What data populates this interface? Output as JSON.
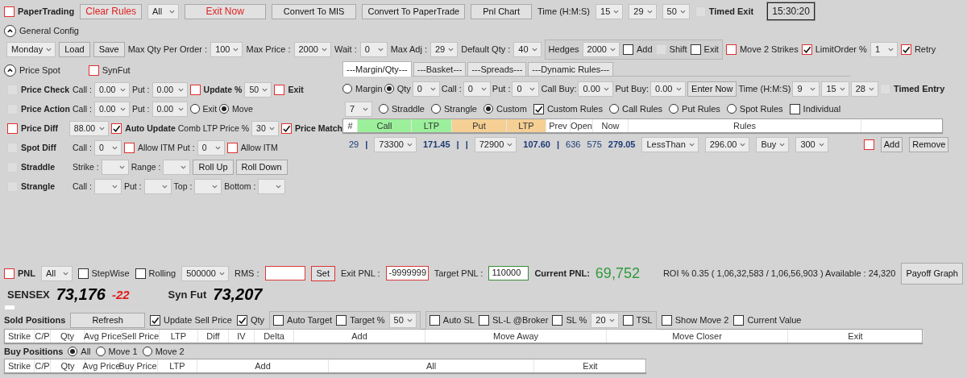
{
  "header_bar": [
    {
      "kind": "check",
      "label": "PaperTrading",
      "checked": false,
      "bold": true,
      "color": "#e0302f"
    },
    {
      "kind": "button",
      "label": "Clear Rules",
      "alert": true
    },
    {
      "kind": "select",
      "value": "All"
    },
    {
      "kind": "button",
      "label": "Exit Now",
      "alert": true
    },
    {
      "kind": "button",
      "label": "Convert To MIS"
    },
    {
      "kind": "button",
      "label": "Convert To PaperTrade"
    },
    {
      "kind": "button",
      "label": "Pnl Chart"
    },
    {
      "kind": "label",
      "text": "Time (H:M:S)"
    },
    {
      "kind": "select",
      "value": "15"
    },
    {
      "kind": "select",
      "value": "29"
    },
    {
      "kind": "select",
      "value": "50"
    },
    {
      "kind": "check",
      "label": "Timed Exit",
      "checked": false,
      "bold": true,
      "disabled": true
    },
    {
      "kind": "clock",
      "text": "15:30:20"
    }
  ],
  "general_config": {
    "title": "General Config",
    "expanded": true,
    "controls": [
      {
        "kind": "select",
        "value": "Monday"
      },
      {
        "kind": "button",
        "label": "Load"
      },
      {
        "kind": "button",
        "label": "Save"
      },
      {
        "kind": "label",
        "text": "Max Qty Per Order :"
      },
      {
        "kind": "select",
        "value": "100"
      },
      {
        "kind": "label",
        "text": "Max Price :"
      },
      {
        "kind": "select",
        "value": "2000"
      },
      {
        "kind": "label",
        "text": "Wait :"
      },
      {
        "kind": "select",
        "value": "0"
      },
      {
        "kind": "label",
        "text": "Max Adj :"
      },
      {
        "kind": "select",
        "value": "29"
      },
      {
        "kind": "label",
        "text": "Default Qty :"
      },
      {
        "kind": "select",
        "value": "40"
      },
      {
        "kind": "group",
        "items": [
          {
            "kind": "label",
            "text": "Hedges"
          },
          {
            "kind": "select",
            "value": "2000"
          },
          {
            "kind": "check",
            "label": "Add",
            "checked": false
          },
          {
            "kind": "check",
            "label": "Shift",
            "checked": false,
            "disabled": true
          },
          {
            "kind": "check",
            "label": "Exit",
            "checked": false
          }
        ]
      },
      {
        "kind": "check",
        "label": "Move 2 Strikes",
        "checked": false,
        "color": "#e0302f"
      },
      {
        "kind": "check",
        "label": "LimitOrder %",
        "checked": true,
        "color": "#e0302f"
      },
      {
        "kind": "select",
        "value": "1"
      },
      {
        "kind": "check",
        "label": "Retry",
        "checked": true,
        "color": "#e0302f"
      }
    ]
  },
  "price_spot": {
    "title": "Price Spot",
    "expanded": true,
    "controls": [
      {
        "kind": "check",
        "label": "SynFut",
        "checked": false,
        "color": "#e0302f"
      }
    ],
    "options": [
      {
        "controls": [
          {
            "kind": "check",
            "label": "Price Check",
            "checked": false,
            "bold": true,
            "disabled": true
          },
          {
            "kind": "label",
            "text": "Call :"
          },
          {
            "kind": "select",
            "value": "0.00"
          },
          {
            "kind": "label",
            "text": "Put :"
          },
          {
            "kind": "select",
            "value": "0.00"
          },
          {
            "kind": "check",
            "label": "Update %",
            "checked": false,
            "bold": true,
            "color": "#e0302f"
          },
          {
            "kind": "select",
            "value": "50"
          },
          {
            "kind": "check",
            "label": "Exit",
            "checked": false,
            "bold": true,
            "color": "#e0302f"
          }
        ]
      },
      {
        "controls": [
          {
            "kind": "check",
            "label": "Price Action",
            "checked": false,
            "bold": true,
            "disabled": true
          },
          {
            "kind": "label",
            "text": "Call :"
          },
          {
            "kind": "select",
            "value": "0.00"
          },
          {
            "kind": "label",
            "text": "Put :"
          },
          {
            "kind": "select",
            "value": "0.00"
          },
          {
            "kind": "radio",
            "label": "Exit",
            "selected": false
          },
          {
            "kind": "radio",
            "label": "Move",
            "selected": true
          }
        ]
      },
      {
        "controls": [
          {
            "kind": "check",
            "label": "Price Diff",
            "checked": false,
            "bold": true,
            "color": "#e0302f"
          },
          {
            "kind": "select",
            "value": "88.00"
          },
          {
            "kind": "check",
            "label": "Auto Update",
            "checked": true,
            "bold": true,
            "color": "#e0302f"
          },
          {
            "kind": "label",
            "text": "Comb LTP Price %"
          },
          {
            "kind": "select",
            "value": "30"
          },
          {
            "kind": "check",
            "label": "Price Match",
            "checked": true,
            "bold": true,
            "color": "#e0302f"
          }
        ]
      },
      {
        "controls": [
          {
            "kind": "check",
            "label": "Spot Diff",
            "checked": false,
            "bold": true,
            "disabled": true
          },
          {
            "kind": "label",
            "text": "Call :"
          },
          {
            "kind": "select",
            "value": "0"
          },
          {
            "kind": "check",
            "label": "Allow ITM",
            "checked": false,
            "color": "#e0302f"
          },
          {
            "kind": "label",
            "text": "Put :"
          },
          {
            "kind": "select",
            "value": "0"
          },
          {
            "kind": "check",
            "label": "Allow ITM",
            "checked": false,
            "color": "#e0302f"
          }
        ]
      },
      {
        "controls": [
          {
            "kind": "check",
            "label": "Straddle",
            "checked": false,
            "bold": true,
            "disabled": true
          },
          {
            "kind": "label",
            "text": "Strike :"
          },
          {
            "kind": "select"
          },
          {
            "kind": "label",
            "text": "Range :"
          },
          {
            "kind": "select"
          },
          {
            "kind": "button",
            "label": "Roll Up"
          },
          {
            "kind": "button",
            "label": "Roll Down"
          }
        ]
      },
      {
        "controls": [
          {
            "kind": "check",
            "label": "Strangle",
            "checked": false,
            "bold": true,
            "disabled": true
          },
          {
            "kind": "label",
            "text": "Call :"
          },
          {
            "kind": "select"
          },
          {
            "kind": "label",
            "text": "Put :"
          },
          {
            "kind": "select"
          },
          {
            "kind": "label",
            "text": "Top :"
          },
          {
            "kind": "select"
          },
          {
            "kind": "label",
            "text": "Bottom :"
          },
          {
            "kind": "select"
          }
        ]
      }
    ]
  },
  "strategy_panel": {
    "tabs": [
      {
        "label": "---Margin/Qty---",
        "selected": true
      },
      {
        "label": "---Basket---",
        "selected": false
      },
      {
        "label": "---Spreads---",
        "selected": false
      },
      {
        "label": "---Dynamic Rules---",
        "selected": false
      }
    ],
    "entry_row": [
      {
        "kind": "radio",
        "label": "Margin",
        "selected": false
      },
      {
        "kind": "radio",
        "label": "Qty",
        "selected": true
      },
      {
        "kind": "select",
        "value": "0"
      },
      {
        "kind": "label",
        "text": "Call :"
      },
      {
        "kind": "select",
        "value": "0"
      },
      {
        "kind": "label",
        "text": "Put :"
      },
      {
        "kind": "select",
        "value": "0"
      },
      {
        "kind": "label",
        "text": "Call Buy:"
      },
      {
        "kind": "select",
        "value": "0.00"
      },
      {
        "kind": "label",
        "text": "Put Buy:"
      },
      {
        "kind": "select",
        "value": "0.00"
      },
      {
        "kind": "button",
        "label": "Enter Now"
      },
      {
        "kind": "label",
        "text": "Time (H:M:S)"
      },
      {
        "kind": "select",
        "value": "9"
      },
      {
        "kind": "select",
        "value": "15"
      },
      {
        "kind": "select",
        "value": "28"
      },
      {
        "kind": "check",
        "label": "Timed Entry",
        "checked": false,
        "bold": true,
        "disabled": true
      }
    ],
    "mode_row": [
      {
        "kind": "select",
        "value": "7"
      },
      {
        "kind": "radio",
        "label": "Straddle",
        "selected": false
      },
      {
        "kind": "radio",
        "label": "Strangle",
        "selected": false
      },
      {
        "kind": "radio",
        "label": "Custom",
        "selected": true
      },
      {
        "kind": "check",
        "label": "Custom Rules",
        "checked": true
      },
      {
        "kind": "radio",
        "label": "Call Rules",
        "selected": false
      },
      {
        "kind": "radio",
        "label": "Put Rules",
        "selected": false
      },
      {
        "kind": "radio",
        "label": "Spot Rules",
        "selected": false
      },
      {
        "kind": "check",
        "label": "Individual",
        "checked": false
      }
    ],
    "rule_columns": [
      {
        "label": "#"
      },
      {
        "label": "Call",
        "color": "#9cf09c"
      },
      {
        "label": "LTP",
        "color": "#9cf09c"
      },
      {
        "label": "Put",
        "color": "#f5cf94"
      },
      {
        "label": "LTP",
        "color": "#f5cf94"
      },
      {
        "label": "Prev"
      },
      {
        "label": "Open"
      },
      {
        "label": "Now"
      },
      {
        "label": "Rules"
      }
    ],
    "rule_line": [
      {
        "kind": "num",
        "text": "29"
      },
      {
        "kind": "num",
        "text": "|",
        "bold": true
      },
      {
        "kind": "select",
        "value": "73300"
      },
      {
        "kind": "num",
        "text": "171.45",
        "bold": true
      },
      {
        "kind": "num",
        "text": "|",
        "bold": true
      },
      {
        "kind": "num",
        "text": "|",
        "bold": true
      },
      {
        "kind": "select",
        "value": "72900"
      },
      {
        "kind": "num",
        "text": "107.60",
        "bold": true
      },
      {
        "kind": "num",
        "text": "|",
        "bold": true
      },
      {
        "kind": "num",
        "text": "636"
      },
      {
        "kind": "num",
        "text": "575"
      },
      {
        "kind": "num",
        "text": "279.05",
        "bold": true
      },
      {
        "kind": "select",
        "value": "LessThan"
      },
      {
        "kind": "select",
        "value": "296.00"
      },
      {
        "kind": "select",
        "value": "Buy"
      },
      {
        "kind": "select",
        "value": "300"
      },
      {
        "kind": "check",
        "checked": false,
        "color": "#e0302f"
      },
      {
        "kind": "button",
        "label": "Add"
      },
      {
        "kind": "button",
        "label": "Remove"
      }
    ]
  },
  "pnl_bar": [
    {
      "kind": "check",
      "label": "PNL",
      "checked": false,
      "bold": true,
      "color": "#e0302f"
    },
    {
      "kind": "select",
      "value": "All"
    },
    {
      "kind": "check",
      "label": "StepWise",
      "checked": false
    },
    {
      "kind": "check",
      "label": "Rolling",
      "checked": false
    },
    {
      "kind": "select",
      "value": "500000"
    },
    {
      "kind": "label",
      "text": "RMS :"
    },
    {
      "kind": "field",
      "color": "#d83a3a"
    },
    {
      "kind": "button",
      "label": "Set",
      "outlined": true
    },
    {
      "kind": "label",
      "text": "Exit PNL :"
    },
    {
      "kind": "field",
      "value": "-9999999",
      "color": "#d83a3a"
    },
    {
      "kind": "label",
      "text": "Target PNL :"
    },
    {
      "kind": "field",
      "value": "110000",
      "color": "#3a8a3a"
    },
    {
      "kind": "label",
      "text": "Current PNL:",
      "bold": true
    },
    {
      "kind": "gain",
      "text": "69,752"
    },
    {
      "kind": "label",
      "text": "ROI % 0.35 ( 1,06,32,583 / 1,06,56,903 ) Available : 24,320"
    },
    {
      "kind": "button",
      "label": "Payoff Graph"
    }
  ],
  "ticker": [
    {
      "kind": "label",
      "text": "SENSEX",
      "bold": true
    },
    {
      "kind": "figure",
      "text": "73,176"
    },
    {
      "kind": "loss",
      "text": "-22"
    },
    {
      "kind": "label",
      "text": "Syn Fut",
      "bold": true
    },
    {
      "kind": "figure",
      "text": "73,207"
    }
  ],
  "sold_positions": {
    "toolbar": [
      {
        "kind": "label",
        "text": "Sold Positions",
        "bold": true
      },
      {
        "kind": "button",
        "label": "Refresh"
      },
      {
        "kind": "check",
        "label": "Update Sell Price",
        "checked": true
      },
      {
        "kind": "check",
        "label": "Qty",
        "checked": true
      },
      {
        "kind": "group",
        "items": [
          {
            "kind": "check",
            "label": "Auto Target",
            "checked": false
          },
          {
            "kind": "check",
            "label": "Target %",
            "checked": false
          },
          {
            "kind": "select",
            "value": "50"
          }
        ]
      },
      {
        "kind": "group",
        "items": [
          {
            "kind": "check",
            "label": "Auto SL",
            "checked": false
          },
          {
            "kind": "check",
            "label": "SL-L @Broker",
            "checked": false
          },
          {
            "kind": "check",
            "label": "SL %",
            "checked": false
          },
          {
            "kind": "select",
            "value": "20"
          },
          {
            "kind": "check",
            "label": "TSL",
            "checked": false
          }
        ]
      },
      {
        "kind": "check",
        "label": "Show Move 2",
        "checked": false
      },
      {
        "kind": "check",
        "label": "Current Value",
        "checked": false
      }
    ],
    "columns": [
      "Strike",
      "C/P",
      "Qty",
      "Avg Price",
      "Sell Price",
      "LTP",
      "Diff",
      "IV",
      "Delta",
      "Add",
      "Move Away",
      "Move Closer",
      "Exit"
    ]
  },
  "buy_positions": {
    "toolbar": [
      {
        "kind": "label",
        "text": "Buy Positions",
        "bold": true
      },
      {
        "kind": "radio",
        "label": "All",
        "selected": true
      },
      {
        "kind": "radio",
        "label": "Move 1",
        "selected": false
      },
      {
        "kind": "radio",
        "label": "Move 2",
        "selected": false
      }
    ],
    "columns": [
      "Strike",
      "C/P",
      "Qty",
      "Avg Price",
      "Buy Price",
      "LTP",
      "Add",
      "All",
      "Exit"
    ]
  }
}
